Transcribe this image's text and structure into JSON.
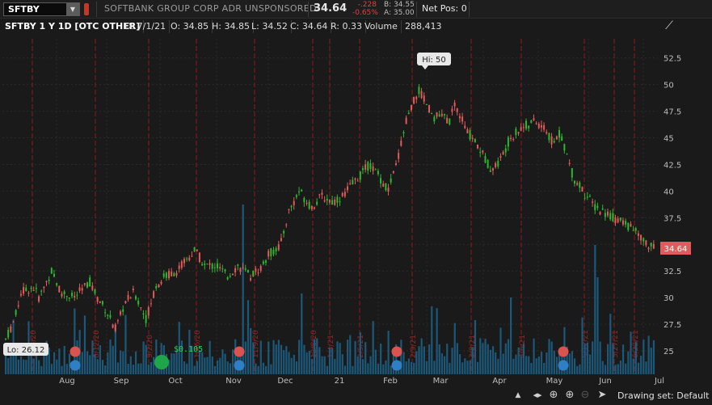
{
  "header": {
    "symbol": "SFTBY",
    "company": "SOFTBANK GROUP CORP ADR UNSPONSORED",
    "last": "34.64",
    "change": "-.228",
    "change_pct": "-0.65%",
    "bid": "B: 34.55",
    "ask": "A: 35.00",
    "net_pos": "Net Pos: 0"
  },
  "info": {
    "title": "SFTBY 1 Y 1D [OTC OTHER]",
    "date": "D: 7/1/21",
    "open": "O: 34.85",
    "high": "H: 34.85",
    "low": "L: 34.52",
    "close": "C: 34.64",
    "range": "R: 0.33",
    "volume_label": "Volume",
    "volume": "288,413"
  },
  "chart_data": {
    "type": "candlestick",
    "y_ticks": [
      "52.5",
      "50",
      "47.5",
      "45",
      "42.5",
      "40",
      "37.5",
      "35",
      "32.5",
      "30",
      "27.5",
      "25"
    ],
    "ylim": [
      22.8,
      54.3
    ],
    "x_months": [
      "Aug",
      "Sep",
      "Oct",
      "Nov",
      "Dec",
      "21",
      "Feb",
      "Mar",
      "Apr",
      "May",
      "Jun",
      "Jul"
    ],
    "hi_label": "Hi: 50",
    "lo_label": "Lo: 26.12",
    "last_price_label": "34.64",
    "dividend_label": "$0.105",
    "event_dates": [
      "7/28/20",
      "8/12/20",
      "9/2/20",
      "10/6/20",
      "11/9/20",
      "12/8/20",
      "1/4/21",
      "2/5/21",
      "2/9/21",
      "3/8/21",
      "4/6/21",
      "5/12/21",
      "5/27/21",
      "6/22/21"
    ],
    "grid": "on",
    "colors": {
      "up": "#2db82d",
      "down": "#e35a5a",
      "volume": "#1d5f85",
      "event_line": "#8b1a1a",
      "background": "#1a1a1a"
    }
  },
  "toolbar": {
    "drawing_set": "Drawing set: Default"
  }
}
